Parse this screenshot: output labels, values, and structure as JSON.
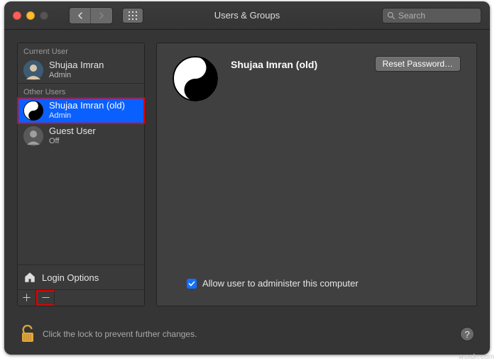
{
  "window": {
    "title": "Users & Groups"
  },
  "search": {
    "placeholder": "Search"
  },
  "sidebar": {
    "current_user_label": "Current User",
    "other_users_label": "Other Users",
    "login_options_label": "Login Options",
    "users": [
      {
        "name": "Shujaa Imran",
        "role": "Admin"
      },
      {
        "name": "Shujaa Imran (old)",
        "role": "Admin"
      },
      {
        "name": "Guest User",
        "role": "Off"
      }
    ]
  },
  "main": {
    "display_name": "Shujaa Imran (old)",
    "reset_password_label": "Reset Password…",
    "allow_admin_label": "Allow user to administer this computer"
  },
  "footer": {
    "lock_hint": "Click the lock to prevent further changes."
  },
  "watermark": "wsxdn.com"
}
